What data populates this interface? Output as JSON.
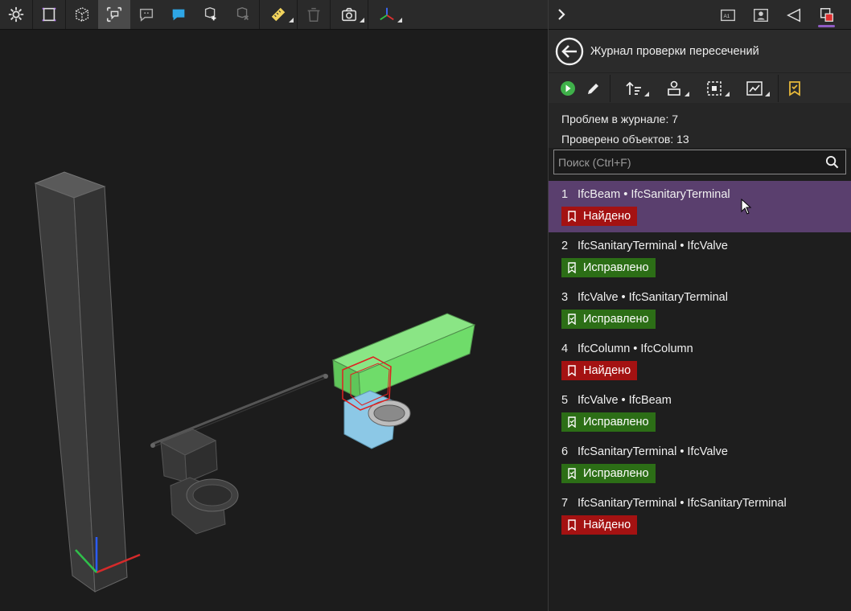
{
  "viewport_toolbar": {
    "icons": [
      "settings-icon",
      "section-box-icon",
      "wireframe-cube-icon",
      "comment-frame-icon",
      "comment-icon",
      "comment-filled-icon",
      "add-to-group-icon",
      "remove-from-group-icon",
      "measure-icon",
      "delete-icon",
      "camera-icon",
      "axes-icon"
    ]
  },
  "panel": {
    "top_icons": [
      "ai-text-icon",
      "user-card-icon",
      "triangle-flag-icon",
      "clash-icon"
    ],
    "title": "Журнал проверки пересечений",
    "stats": {
      "problems": "Проблем в журнале: 7",
      "checked": "Проверено объектов: 13"
    },
    "search": {
      "placeholder": "Поиск (Ctrl+F)",
      "value": ""
    },
    "issues": [
      {
        "num": "1",
        "title": "IfcBeam • IfcSanitaryTerminal",
        "status": "Найдено",
        "state": "found"
      },
      {
        "num": "2",
        "title": "IfcSanitaryTerminal • IfcValve",
        "status": "Исправлено",
        "state": "fixed"
      },
      {
        "num": "3",
        "title": "IfcValve • IfcSanitaryTerminal",
        "status": "Исправлено",
        "state": "fixed"
      },
      {
        "num": "4",
        "title": "IfcColumn • IfcColumn",
        "status": "Найдено",
        "state": "found"
      },
      {
        "num": "5",
        "title": "IfcValve • IfcBeam",
        "status": "Исправлено",
        "state": "fixed"
      },
      {
        "num": "6",
        "title": "IfcSanitaryTerminal • IfcValve",
        "status": "Исправлено",
        "state": "fixed"
      },
      {
        "num": "7",
        "title": "IfcSanitaryTerminal • IfcSanitaryTerminal",
        "status": "Найдено",
        "state": "found"
      }
    ]
  },
  "colors": {
    "found": "#a41212",
    "fixed": "#2c6e16",
    "selected_row": "#5a3f6e",
    "accent": "#8e5cc4",
    "beam_green": "#6fdc6a",
    "terminal_blue": "#8cc8e6"
  }
}
